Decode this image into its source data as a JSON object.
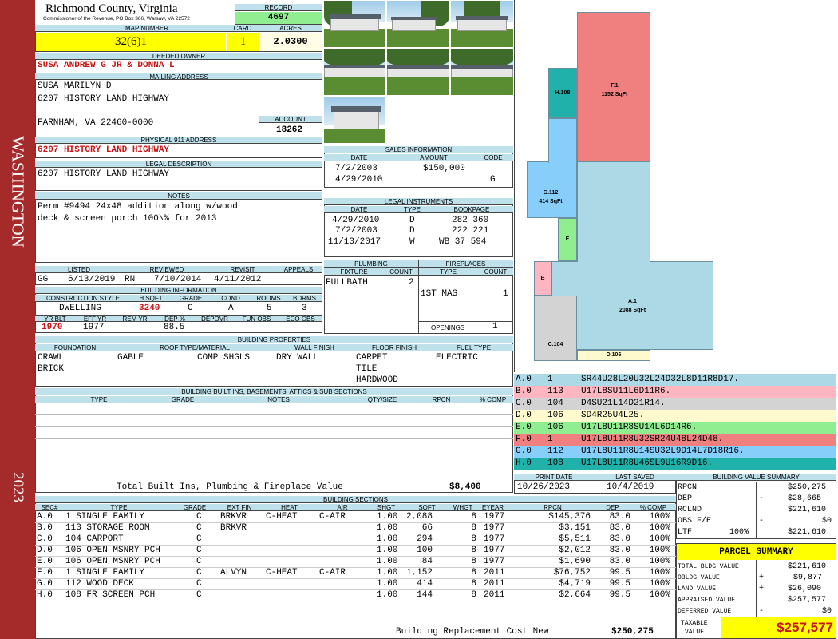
{
  "sidebar": {
    "city": "WASHINGTON",
    "year": "2023"
  },
  "header": {
    "county": "Richmond County, Virginia",
    "address": "Commissioner of the Revenue, PO Box 366, Warsaw, VA 22572",
    "record_label": "RECORD",
    "record": "4697",
    "map_label": "MAP NUMBER",
    "map": "32(6)1",
    "card_label": "CARD",
    "card": "1",
    "acres_label": "ACRES",
    "acres": "2.0300"
  },
  "owner": {
    "label": "DEEDED OWNER",
    "name": "SUSA ANDREW G JR & DONNA L",
    "mail_label": "MAILING ADDRESS",
    "mail1": "SUSA MARILYN D",
    "mail2": "6207 HISTORY LAND HIGHWAY",
    "mail3": "FARNHAM, VA 22460-0000",
    "acct_label": "ACCOUNT",
    "account": "18262"
  },
  "physical": {
    "label": "PHYSICAL 911 ADDRESS",
    "value": "6207 HISTORY LAND HIGHWAY"
  },
  "legal": {
    "label": "LEGAL DESCRIPTION",
    "value": "6207 HISTORY LAND HIGHWAY"
  },
  "notes": {
    "label": "NOTES",
    "line1": "Perm #9494 24x48 addition along w/wood",
    "line2": "deck & screen porch 100\\% for 2013"
  },
  "sales": {
    "label": "SALES INFORMATION",
    "h_date": "DATE",
    "h_amount": "AMOUNT",
    "h_code": "CODE",
    "rows": [
      {
        "date": "7/2/2003",
        "amount": "$150,000",
        "code": ""
      },
      {
        "date": "4/29/2010",
        "amount": "",
        "code": "G"
      }
    ]
  },
  "instruments": {
    "label": "LEGAL INSTRUMENTS",
    "h_date": "DATE",
    "h_type": "TYPE",
    "h_book": "BOOKPAGE",
    "rows": [
      {
        "date": "4/29/2010",
        "type": "D",
        "book": "282 360"
      },
      {
        "date": "7/2/2003",
        "type": "D",
        "book": "222 221"
      },
      {
        "date": "11/13/2017",
        "type": "W",
        "book": "WB 37 594"
      }
    ]
  },
  "listed": {
    "l_listed": "LISTED",
    "l_reviewed": "REVIEWED",
    "l_revisit": "REVISIT",
    "l_appeals": "APPEALS",
    "who1": "GG",
    "date1": "6/13/2019",
    "who2": "RN",
    "date2": "7/10/2014",
    "revisit": "4/11/2012"
  },
  "building": {
    "label": "BUILDING INFORMATION",
    "h_style": "CONSTRUCTION STYLE",
    "h_hsqft": "H SQFT",
    "h_grade": "GRADE",
    "h_cond": "COND",
    "h_rooms": "ROOMS",
    "h_bdrms": "BDRMS",
    "style": "DWELLING",
    "hsqft": "3240",
    "grade": "C",
    "cond": "A",
    "rooms": "5",
    "bdrms": "3",
    "h_yrblt": "YR BLT",
    "h_effyr": "EFF YR",
    "h_remyr": "REM YR",
    "h_dep": "DEP %",
    "h_depovr": "DEPOVR",
    "h_funobs": "FUN OBS",
    "h_ecoobs": "ECO OBS",
    "yrblt": "1970",
    "effyr": "1977",
    "dep": "88.5"
  },
  "plumbing": {
    "label": "PLUMBING",
    "h_fixture": "FIXTURE",
    "h_count": "COUNT",
    "fixture": "FULLBATH",
    "count": "2"
  },
  "fireplaces": {
    "label": "FIREPLACES",
    "h_type": "TYPE",
    "h_count": "COUNT",
    "type": "1ST MAS",
    "count": "1",
    "openings_label": "OPENINGS",
    "openings": "1"
  },
  "properties": {
    "label": "BUILDING PROPERTIES",
    "h_found": "FOUNDATION",
    "h_roof": "ROOF TYPE/MATERIAL",
    "h_wall": "WALL FINISH",
    "h_floor": "FLOOR FINISH",
    "h_fuel": "FUEL TYPE",
    "found1": "CRAWL",
    "found2": "BRICK",
    "roof1": "GABLE",
    "roof2": "COMP SHGLS",
    "wall": "DRY WALL",
    "floor1": "CARPET",
    "floor2": "TILE",
    "floor3": "HARDWOOD",
    "fuel": "ELECTRIC"
  },
  "builtins": {
    "label": "BUILDING BUILT INS, BASEMENTS, ATTICS & SUB SECTIONS",
    "h_type": "TYPE",
    "h_grade": "GRADE",
    "h_notes": "NOTES",
    "h_qty": "QTY/SIZE",
    "h_rpcn": "RPCN",
    "h_comp": "% COMP",
    "total_label": "Total Built Ins, Plumbing & Fireplace Value",
    "total": "$8,400"
  },
  "print": {
    "h_print": "PRINT DATE",
    "h_saved": "LAST SAVED",
    "print": "10/26/2023",
    "saved": "10/4/2019"
  },
  "sections": {
    "label": "BUILDING SECTIONS",
    "headers": [
      "SEC#",
      "TYPE",
      "GRADE",
      "EXT FIN",
      "HEAT",
      "AIR",
      "SHGT",
      "SQFT",
      "WHGT",
      "EYEAR",
      "RPCN",
      "DEP",
      "% COMP"
    ],
    "rows": [
      [
        "A.0",
        "1 SINGLE FAMILY",
        "C",
        "BRKVR",
        "C-HEAT",
        "C-AIR",
        "1.00",
        "2,088",
        "8",
        "1977",
        "$145,376",
        "83.0",
        "100%"
      ],
      [
        "B.0",
        "113 STORAGE ROOM",
        "C",
        "BRKVR",
        "",
        "",
        "1.00",
        "66",
        "8",
        "1977",
        "$3,151",
        "83.0",
        "100%"
      ],
      [
        "C.0",
        "104 CARPORT",
        "C",
        "",
        "",
        "",
        "1.00",
        "294",
        "8",
        "1977",
        "$5,511",
        "83.0",
        "100%"
      ],
      [
        "D.0",
        "106 OPEN MSNRY PCH",
        "C",
        "",
        "",
        "",
        "1.00",
        "100",
        "8",
        "1977",
        "$2,012",
        "83.0",
        "100%"
      ],
      [
        "E.0",
        "106 OPEN MSNRY PCH",
        "C",
        "",
        "",
        "",
        "1.00",
        "84",
        "8",
        "1977",
        "$1,690",
        "83.0",
        "100%"
      ],
      [
        "F.0",
        "1 SINGLE FAMILY",
        "C",
        "ALVYN",
        "C-HEAT",
        "C-AIR",
        "1.00",
        "1,152",
        "8",
        "2011",
        "$76,752",
        "99.5",
        "100%"
      ],
      [
        "G.0",
        "112 WOOD DECK",
        "C",
        "",
        "",
        "",
        "1.00",
        "414",
        "8",
        "2011",
        "$4,719",
        "99.5",
        "100%"
      ],
      [
        "H.0",
        "108 FR SCREEN PCH",
        "C",
        "",
        "",
        "",
        "1.00",
        "144",
        "8",
        "2011",
        "$2,664",
        "99.5",
        "100%"
      ]
    ],
    "brcn_label": "Building Replacement Cost New",
    "brcn": "$250,275"
  },
  "legend": [
    {
      "sec": "A.0",
      "code": "1",
      "path": "SR44U28L20U32L24D32L8D11R8D17.",
      "color": "#add8e6"
    },
    {
      "sec": "B.0",
      "code": "113",
      "path": "U17L8SU11L6D11R6.",
      "color": "#ffb6c1"
    },
    {
      "sec": "C.0",
      "code": "104",
      "path": "D4SU21L14D21R14.",
      "color": "#d3d3d3"
    },
    {
      "sec": "D.0",
      "code": "106",
      "path": "SD4R25U4L25.",
      "color": "#fffacd"
    },
    {
      "sec": "E.0",
      "code": "106",
      "path": "U17L8U11R8SU14L6D14R6.",
      "color": "#90ee90"
    },
    {
      "sec": "F.0",
      "code": "1",
      "path": "U17L8U11R8U32SR24U48L24D48.",
      "color": "#f08080"
    },
    {
      "sec": "G.0",
      "code": "112",
      "path": "U17L8U11R8U14SU32L9D14L7D18R16.",
      "color": "#87cefa"
    },
    {
      "sec": "H.0",
      "code": "108",
      "path": "U17L8U11R8U46SL9U16R9D16.",
      "color": "#20b2aa"
    }
  ],
  "sketch": {
    "f_name": "F.1",
    "f_area": "1152 SqFt",
    "h_name": "H.108",
    "g_name": "G.112",
    "g_area": "414 SqFt",
    "a_name": "A.1",
    "a_area": "2088 SqFt",
    "b_name": "B",
    "c_name": "C.104",
    "d_name": "D.106",
    "e_name": "E"
  },
  "value_summary": {
    "label": "BUILDING VALUE SUMMARY",
    "rpcn_l": "RPCN",
    "rpcn": "$250,275",
    "dep_l": "DEP",
    "dep_sign": "-",
    "dep": "$28,665",
    "rclnd_l": "RCLND",
    "rclnd": "$221,610",
    "obs_l": "OBS F/E",
    "obs_sign": "-",
    "obs": "$0",
    "ltf_l": "LTF",
    "ltf_pct": "100%",
    "ltf": "$221,610"
  },
  "parcel": {
    "label": "PARCEL SUMMARY",
    "bldg_l": "TOTAL BLDG VALUE",
    "bldg": "$221,610",
    "obldg_l": "OBLDG VALUE",
    "obldg_sign": "+",
    "obldg": "$9,877",
    "land_l": "LAND VALUE",
    "land_sign": "+",
    "land": "$26,090",
    "appr_l": "APPRAISED VALUE",
    "appr": "$257,577",
    "def_l": "DEFERRED VALUE",
    "def_sign": "-",
    "def": "$0",
    "tax_l1": "TAXABLE",
    "tax_l2": "VALUE",
    "taxable": "$257,577"
  }
}
